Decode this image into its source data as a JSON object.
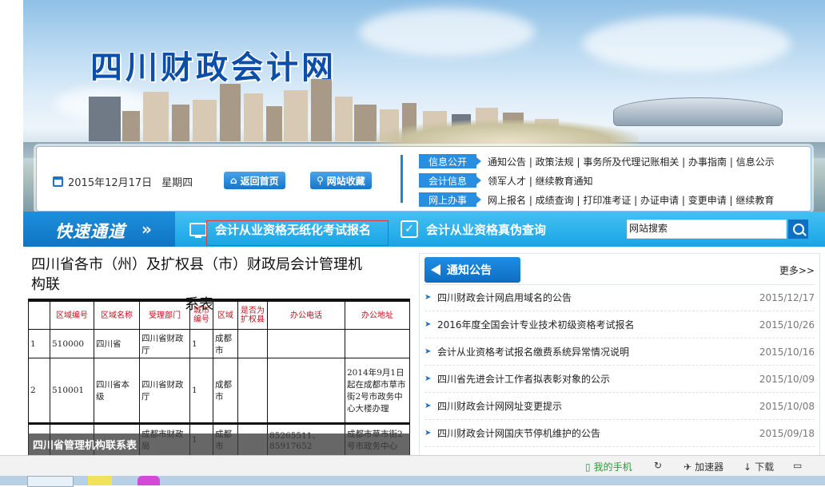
{
  "site": {
    "title": "四川财政会计网"
  },
  "info": {
    "date": "2015年12月17日",
    "weekday": "星期四",
    "home_btn": "返回首页",
    "fav_btn": "网站收藏"
  },
  "nav_rows": [
    {
      "tag": "信息公开",
      "links": "通知公告 | 政策法规 | 事务所及代理记账相关 | 办事指南 | 信息公示"
    },
    {
      "tag": "会计信息",
      "links": "领军人才 | 继续教育通知"
    },
    {
      "tag": "网上办事",
      "links": "网上报名 | 成绩查询 | 打印准考证 | 办证申请 | 变更申请 | 继续教育"
    }
  ],
  "quickbar": {
    "title": "快速通道",
    "arrow": "»",
    "item1": "会计从业资格无纸化考试报名",
    "item2": "会计从业资格真伪查询",
    "search_value": "网站搜索"
  },
  "document": {
    "title_line1": "四川省各市（州）及扩权县（市）财政局会计管理机构联",
    "title_line2": "系表",
    "headers": [
      "",
      "区域编号",
      "区域名称",
      "受理部门",
      "城市编号",
      "区域",
      "是否为扩权县",
      "办公电话",
      "办公地址"
    ],
    "rows": [
      [
        "1",
        "510000",
        "四川省",
        "四川省财政厅",
        "1",
        "成都市",
        "",
        "",
        ""
      ],
      [
        "2",
        "510001",
        "四川省本级",
        "四川省财政厅",
        "1",
        "成都市",
        "",
        "",
        "2014年9月1日起在成都市草市街2号市政务中心大楼办理"
      ],
      [
        "",
        "",
        "",
        "成都市财政局",
        "1",
        "成都市",
        "",
        "85265511、85917652",
        "成都市草市街2号市政务中心"
      ]
    ],
    "caption": "四川省管理机构联系表"
  },
  "notices": {
    "title": "通知公告",
    "more": "更多>>",
    "items": [
      {
        "text": "四川财政会计网启用域名的公告",
        "date": "2015/12/17"
      },
      {
        "text": "2016年度全国会计专业技术初级资格考试报名",
        "date": "2015/10/26"
      },
      {
        "text": "会计从业资格考试报名缴费系统异常情况说明",
        "date": "2015/10/16"
      },
      {
        "text": "四川省先进会计工作者拟表彰对象的公示",
        "date": "2015/10/09"
      },
      {
        "text": "四川财政会计网网址变更提示",
        "date": "2015/10/08"
      },
      {
        "text": "四川财政会计网国庆节停机维护的公告",
        "date": "2015/09/18"
      }
    ]
  },
  "statusbar": {
    "phone": "我的手机",
    "accel": "加速器",
    "download": "下载"
  }
}
